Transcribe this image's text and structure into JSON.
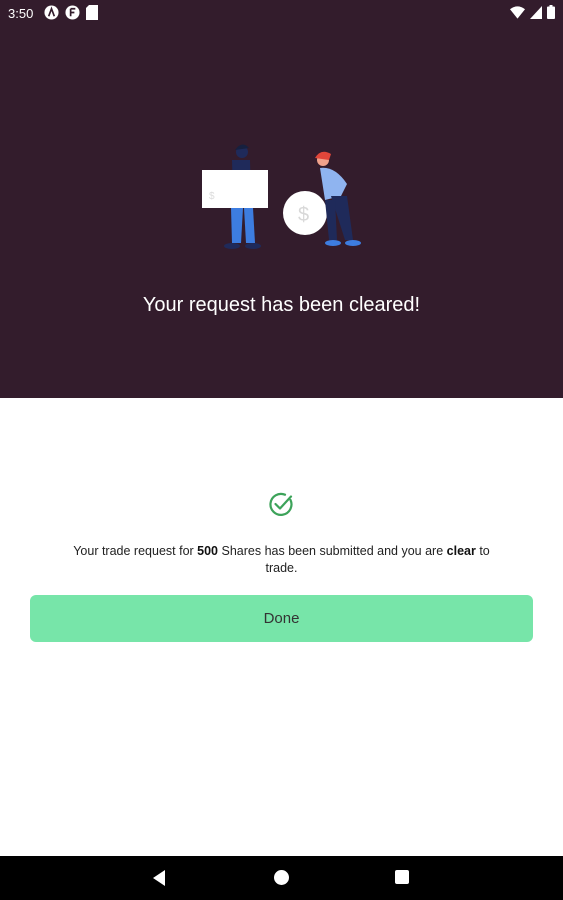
{
  "status_bar": {
    "time": "3:50",
    "left_icons": [
      "accessibility-icon",
      "app-notification-icon",
      "sd-card-icon"
    ],
    "right_icons": [
      "wifi-icon",
      "signal-icon",
      "battery-icon"
    ]
  },
  "header": {
    "title": "Your request has been cleared!",
    "background_color": "#331c2c"
  },
  "confirmation": {
    "icon": "check-circle-icon",
    "message_prefix": "Your trade request for ",
    "share_count": "500",
    "message_middle": " Shares has been submitted and you are ",
    "status_word": "clear",
    "message_suffix": " to trade."
  },
  "done_button": {
    "label": "Done",
    "color": "#77e5a9"
  },
  "nav_bar": {
    "icons": [
      "back-icon",
      "home-icon",
      "recents-icon"
    ]
  }
}
